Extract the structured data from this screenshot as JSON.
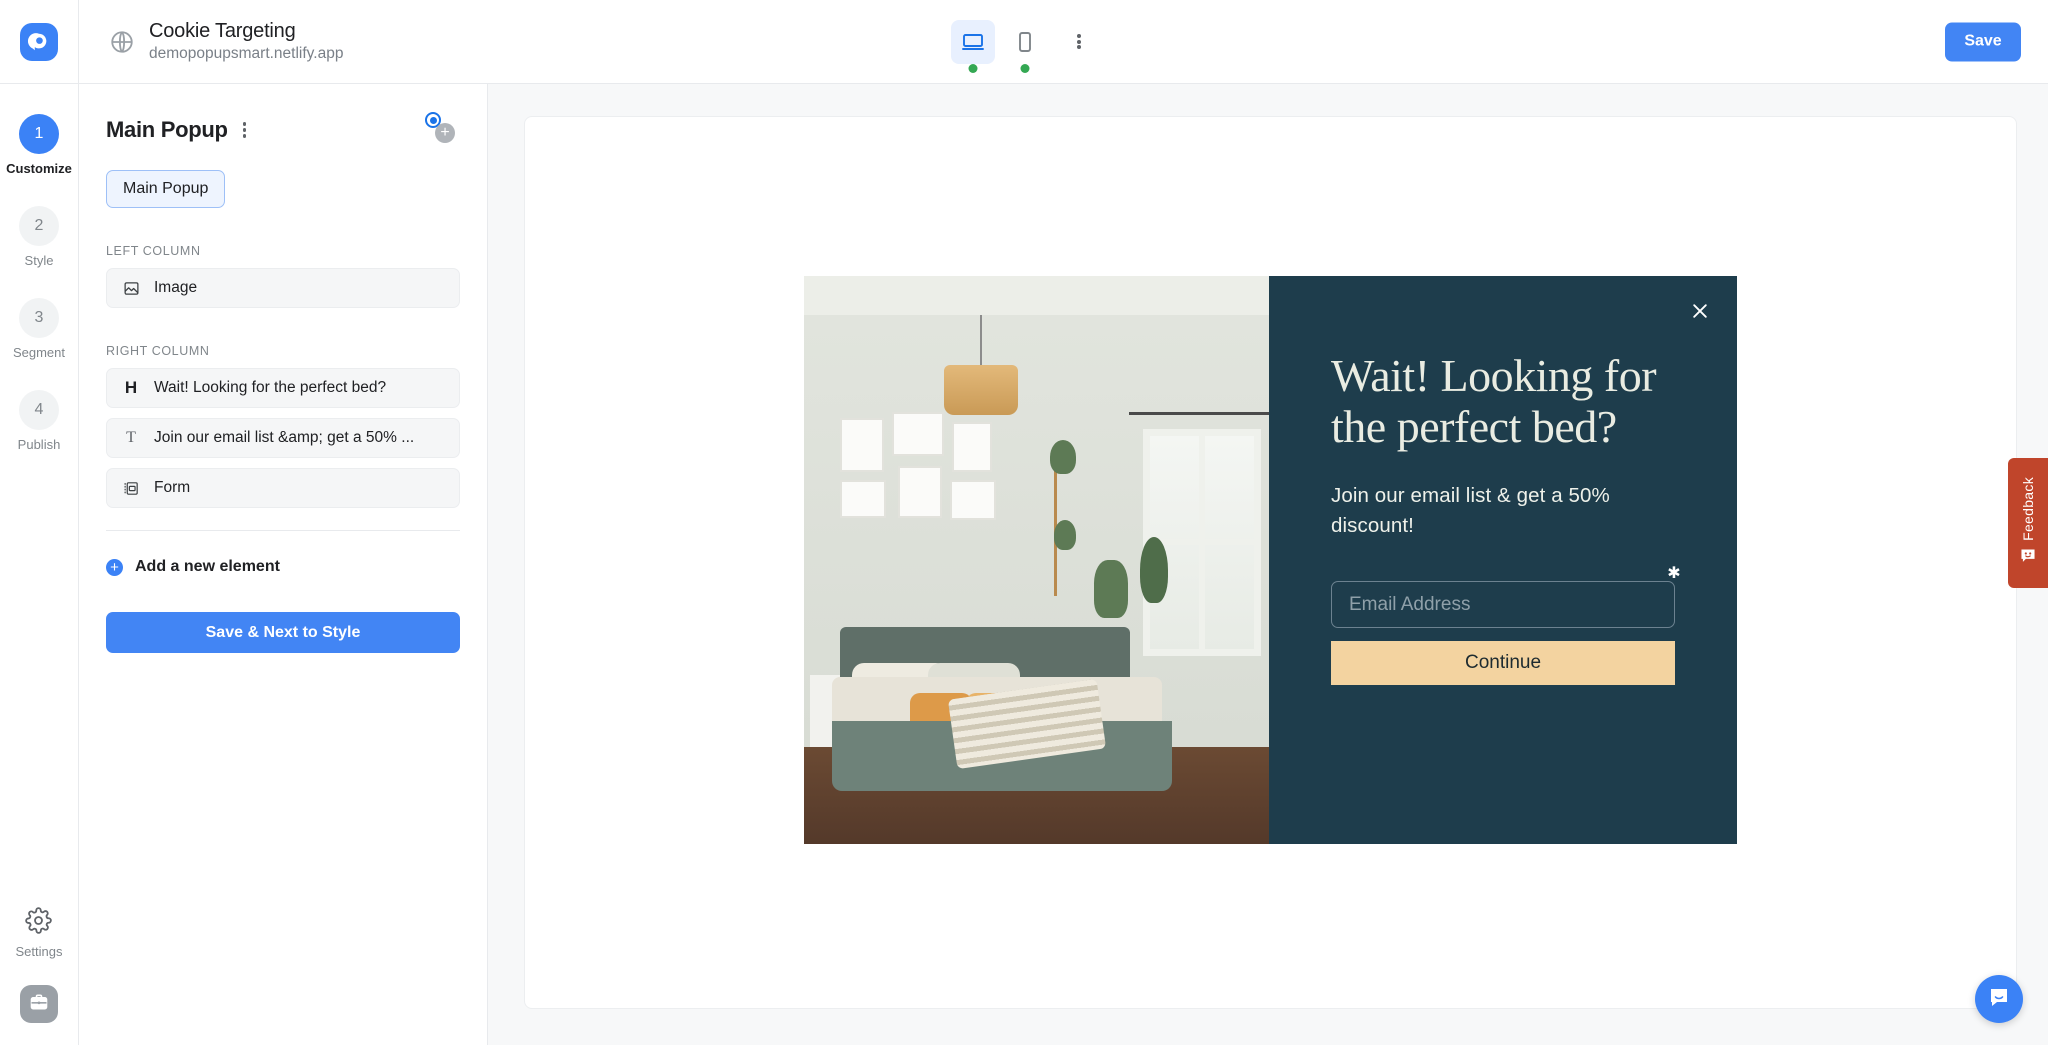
{
  "topbar": {
    "logo_icon": "popupsmart-logo-icon",
    "globe_icon": "globe-icon",
    "doc_title": "Cookie Targeting",
    "doc_url": "demopopupsmart.netlify.app",
    "device_desktop_icon": "desktop-icon",
    "device_mobile_icon": "mobile-icon",
    "more_icon": "kebab-menu-icon",
    "save_label": "Save",
    "accent_color": "#4285f4"
  },
  "rail": {
    "steps": [
      {
        "num": "1",
        "label": "Customize",
        "active": true
      },
      {
        "num": "2",
        "label": "Style",
        "active": false
      },
      {
        "num": "3",
        "label": "Segment",
        "active": false
      },
      {
        "num": "4",
        "label": "Publish",
        "active": false
      }
    ],
    "settings_label": "Settings",
    "settings_icon": "gear-icon",
    "briefcase_icon": "briefcase-icon"
  },
  "panel": {
    "title": "Main Popup",
    "kebab_icon": "kebab-menu-icon",
    "radio_icon": "radio-selected-icon",
    "plus_icon": "plus-circle-icon",
    "tab_label": "Main Popup",
    "left_column_label": "LEFT COLUMN",
    "right_column_label": "RIGHT COLUMN",
    "left_elements": [
      {
        "icon": "image-icon",
        "icon_kind": "image",
        "label": "Image"
      }
    ],
    "right_elements": [
      {
        "icon": "heading-icon",
        "icon_kind": "letter-h",
        "label": "Wait! Looking for the perfect bed?"
      },
      {
        "icon": "text-icon",
        "icon_kind": "letter-t",
        "label": "Join our email list &amp; get a 50% ..."
      },
      {
        "icon": "form-icon",
        "icon_kind": "form",
        "label": "Form"
      }
    ],
    "add_element_label": "Add a new element",
    "add_icon": "plus-circle-icon",
    "next_button_label": "Save & Next to Style"
  },
  "preview": {
    "close_icon": "close-icon",
    "heading": "Wait! Looking for the perfect bed?",
    "paragraph": "Join our email list & get a 50% discount!",
    "email_placeholder": "Email Address",
    "email_value": "",
    "required_marker": "✱",
    "cta_label": "Continue",
    "panel_bg": "#1e3d4c",
    "heading_color": "#e9ece2",
    "cta_bg": "#f3d3a0"
  },
  "feedback": {
    "label": "Feedback",
    "icon": "feedback-smiley-icon",
    "color": "#c0452b"
  },
  "intercom": {
    "icon": "chat-bubble-icon",
    "color": "#3b82f6"
  }
}
